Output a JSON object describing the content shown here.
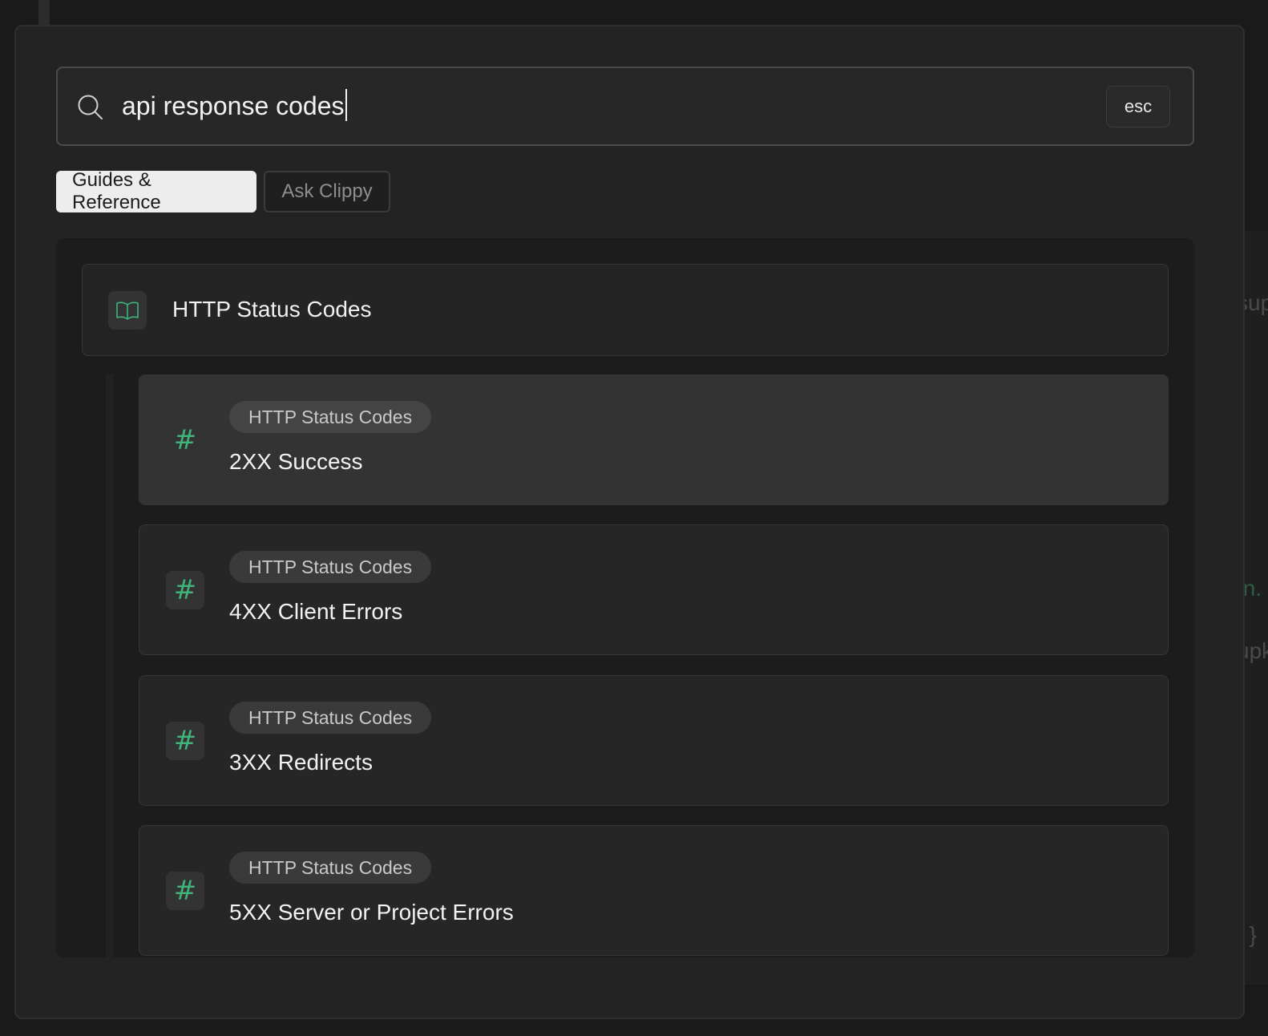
{
  "background": {
    "peek_texts": [
      "sup",
      "In.",
      "upk",
      ": }"
    ]
  },
  "search": {
    "query": "api response codes",
    "esc_label": "esc"
  },
  "tabs": [
    {
      "label": "Guides & Reference",
      "active": true
    },
    {
      "label": "Ask Clippy",
      "active": false
    }
  ],
  "results": {
    "page": {
      "icon": "book-icon",
      "title": "HTTP Status Codes"
    },
    "sections": [
      {
        "icon": "hash-icon",
        "breadcrumb": "HTTP Status Codes",
        "title": "2XX Success",
        "selected": true
      },
      {
        "icon": "hash-icon",
        "breadcrumb": "HTTP Status Codes",
        "title": "4XX Client Errors",
        "selected": false
      },
      {
        "icon": "hash-icon",
        "breadcrumb": "HTTP Status Codes",
        "title": "3XX Redirects",
        "selected": false
      },
      {
        "icon": "hash-icon",
        "breadcrumb": "HTTP Status Codes",
        "title": "5XX Server or Project Errors",
        "selected": false
      }
    ]
  },
  "colors": {
    "accent_green": "#3fb37a",
    "modal_bg": "#232323",
    "active_tab_bg": "#ededed"
  }
}
